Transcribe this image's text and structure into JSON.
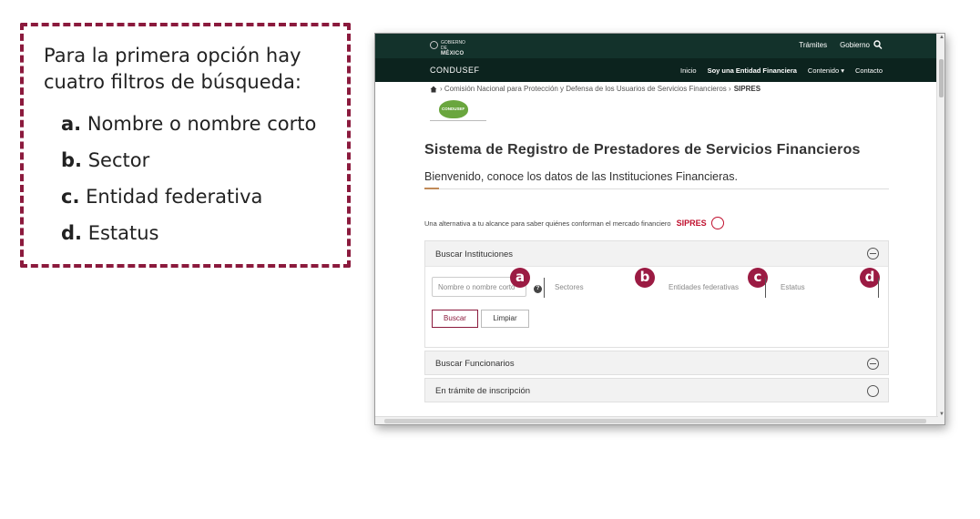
{
  "callout": {
    "intro": "Para la primera opción hay cuatro filtros de búsqueda:",
    "items": [
      {
        "letter": "a.",
        "text": "Nombre o nombre corto"
      },
      {
        "letter": "b.",
        "text": "Sector"
      },
      {
        "letter": "c.",
        "text": "Entidad federativa"
      },
      {
        "letter": "d.",
        "text": "Estatus"
      }
    ]
  },
  "topbar": {
    "logo_small": "GOBIERNO DE",
    "logo_main": "MÉXICO",
    "links": [
      "Trámites",
      "Gobierno"
    ]
  },
  "navbar": {
    "brand": "CONDUSEF",
    "links": [
      {
        "label": "Inicio",
        "bold": false
      },
      {
        "label": "Soy una Entidad Financiera",
        "bold": true
      },
      {
        "label": "Contenido ▾",
        "bold": false
      },
      {
        "label": "Contacto",
        "bold": false
      }
    ]
  },
  "breadcrumb": {
    "path": "› Comisión Nacional para Protección y Defensa de los Usuarios de Servicios Financieros ›",
    "current": "SIPRES"
  },
  "org_logo": "CONDUSEF",
  "page": {
    "title": "Sistema de Registro de Prestadores de Servicios Financieros",
    "subtitle": "Bienvenido, conoce los datos de las Instituciones Financieras.",
    "alternative": "Una alternativa a tu alcance para saber quiénes conforman el mercado financiero",
    "sipres_logo": "SIPRES"
  },
  "search_panel": {
    "header": "Buscar Instituciones",
    "fields": {
      "name_placeholder": "Nombre o nombre corto",
      "help": "?",
      "sector_placeholder": "Sectores",
      "state_placeholder": "Entidades federativas",
      "status_placeholder": "Estatus"
    },
    "badges": [
      "a",
      "b",
      "c",
      "d"
    ],
    "buttons": {
      "search": "Buscar",
      "clear": "Limpiar"
    }
  },
  "other_panels": [
    {
      "label": "Buscar Funcionarios"
    },
    {
      "label": "En trámite de inscripción"
    }
  ]
}
